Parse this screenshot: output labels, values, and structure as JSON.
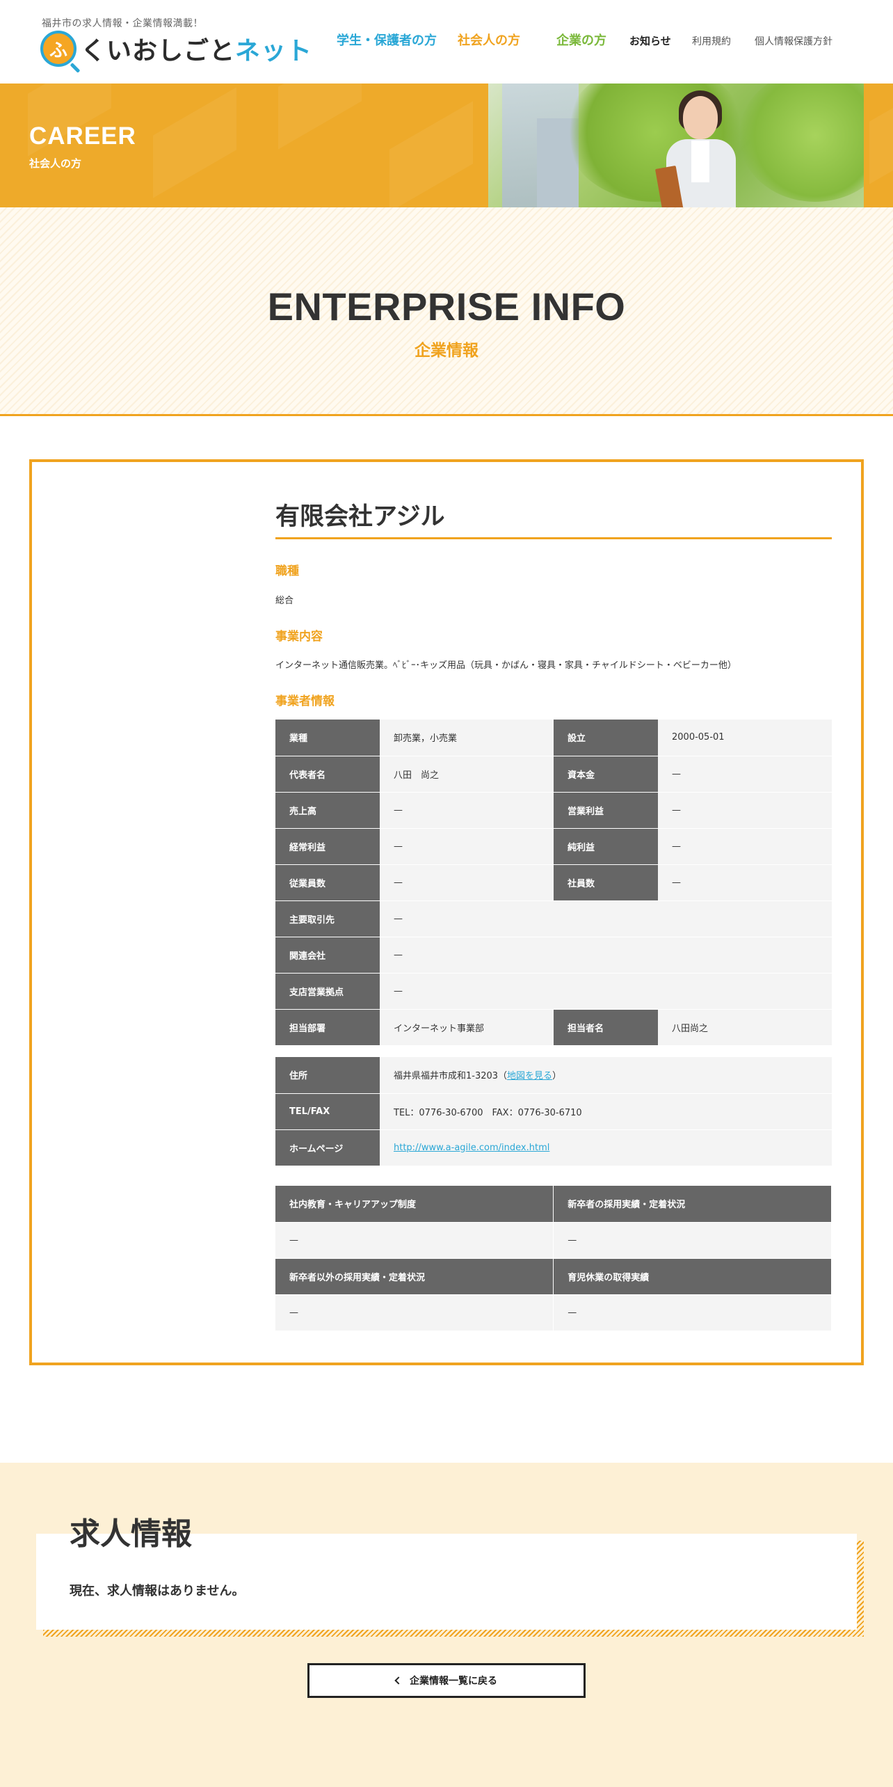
{
  "header": {
    "tagline": "福井市の求人情報・企業情報満載！",
    "logo": {
      "mark": "ふ",
      "text_dark": "くいおしごと",
      "text_accent": "ネット"
    },
    "nav": [
      {
        "label": "学生・保護者の方"
      },
      {
        "label": "社会人の方"
      },
      {
        "label": "企業の方"
      },
      {
        "label": "お知らせ"
      },
      {
        "label": "利用規約"
      },
      {
        "label": "個人情報保護方針"
      }
    ]
  },
  "hero": {
    "title": "CAREER",
    "subtitle": "社会人の方"
  },
  "section": {
    "title_en": "ENTERPRISE INFO",
    "title_jp": "企業情報"
  },
  "company": {
    "name": "有限会社アジル",
    "job_type_heading": "職種",
    "job_type": "総合",
    "business_heading": "事業内容",
    "business": "インターネット通信販売業。ﾍﾞﾋﾞｰ･キッズ用品（玩具・かばん・寝具・家具・チャイルドシート・ベビーカー他）",
    "info_heading": "事業者情報",
    "info": {
      "industry_label": "業種",
      "industry": "卸売業，小売業",
      "founded_label": "設立",
      "founded": "2000-05-01",
      "rep_label": "代表者名",
      "rep": "八田　尚之",
      "capital_label": "資本金",
      "capital": "—",
      "sales_label": "売上高",
      "sales": "—",
      "op_profit_label": "営業利益",
      "op_profit": "—",
      "ord_profit_label": "経常利益",
      "ord_profit": "—",
      "net_profit_label": "純利益",
      "net_profit": "—",
      "employees_label": "従業員数",
      "employees": "—",
      "staff_label": "社員数",
      "staff": "—",
      "clients_label": "主要取引先",
      "clients": "—",
      "affiliates_label": "関連会社",
      "affiliates": "—",
      "branches_label": "支店営業拠点",
      "branches": "—",
      "dept_label": "担当部署",
      "dept": "インターネット事業部",
      "contact_label": "担当者名",
      "contact": "八田尚之"
    },
    "contact_info": {
      "address_label": "住所",
      "address": "福井県福井市成和1-3203（",
      "map_link": "地図を見る",
      "address_end": "）",
      "tel_label": "TEL/FAX",
      "tel": "TEL：0776-30-6700　FAX：0776-30-6710",
      "web_label": "ホームページ",
      "web": "http://www.a-agile.com/index.html"
    },
    "hr": {
      "h1": "社内教育・キャリアアップ制度",
      "v1": "—",
      "h2": "新卒者の採用実績・定着状況",
      "v2": "—",
      "h3": "新卒者以外の採用実績・定着状況",
      "v3": "—",
      "h4": "育児休業の取得実績",
      "v4": "—"
    }
  },
  "jobs": {
    "title": "求人情報",
    "empty": "現在、求人情報はありません。",
    "back_label": "企業情報一覧に戻る"
  },
  "colors": {
    "accent": "#f0a31f",
    "blue": "#2aa7d6",
    "green": "#7ab83a",
    "label_bg": "#666666"
  }
}
